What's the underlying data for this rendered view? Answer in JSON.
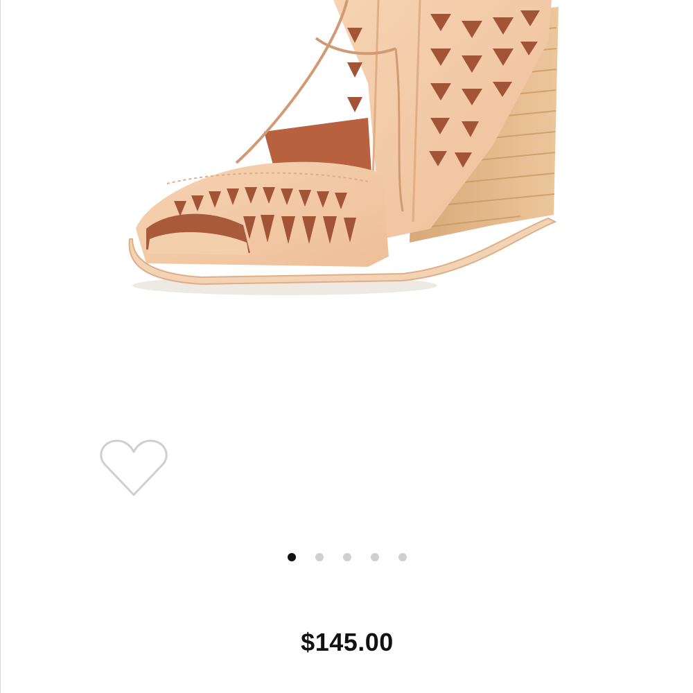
{
  "product": {
    "image_icon": "wedge-sandal-photo",
    "price": "$145.00"
  },
  "favorite": {
    "icon": "heart-outline-icon"
  },
  "carousel": {
    "active_index": 0,
    "count": 5
  },
  "colors": {
    "leather": "#f2c9a6",
    "leather_dark": "#d9a37c",
    "cutout": "#9a4a30",
    "wood": "#e3b987",
    "wood_line": "#c9955f",
    "sole": "#f6d8bc",
    "heart_stroke": "#cfcfcf",
    "dot_active": "#111111",
    "dot_inactive": "#cfcfcf"
  }
}
